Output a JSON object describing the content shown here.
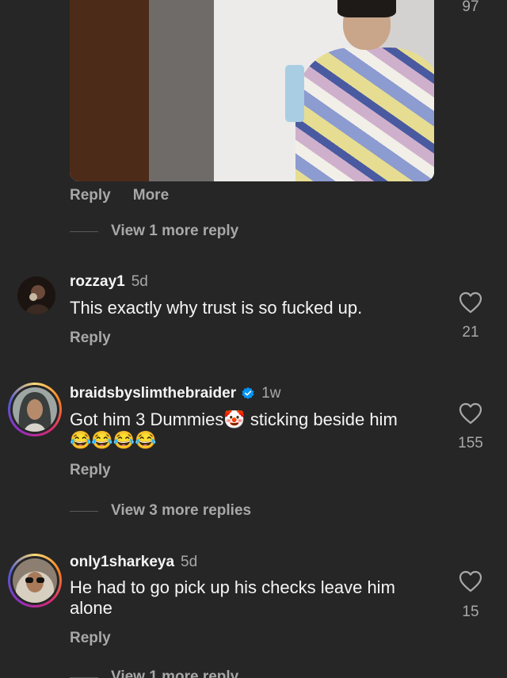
{
  "top_comment": {
    "like_count": "97",
    "reply_label": "Reply",
    "more_label": "More",
    "view_replies": "View 1 more reply"
  },
  "comments": [
    {
      "username": "rozzay1",
      "time": "5d",
      "text": "This exactly why trust is so fucked up.",
      "reply_label": "Reply",
      "like_count": "21",
      "verified": false
    },
    {
      "username": "braidsbyslimthebraider",
      "time": "1w",
      "text_before": "Got him 3 Dummies",
      "emoji_inline": "🤡",
      "text_after": " sticking beside him",
      "emoji_line": "😂😂😂😂",
      "reply_label": "Reply",
      "like_count": "155",
      "verified": true,
      "view_replies": "View 3 more replies"
    },
    {
      "username": "only1sharkeya",
      "time": "5d",
      "text": "He had to go pick up his checks leave him alone",
      "reply_label": "Reply",
      "like_count": "15",
      "verified": false,
      "view_replies": "View 1 more reply"
    }
  ],
  "icons": {
    "like": "heart-outline-icon",
    "verified": "verified-badge-icon"
  },
  "colors": {
    "background": "#262626",
    "primary_text": "#f5f5f5",
    "secondary_text": "#a8a8a8",
    "verified_blue": "#0095f6"
  }
}
